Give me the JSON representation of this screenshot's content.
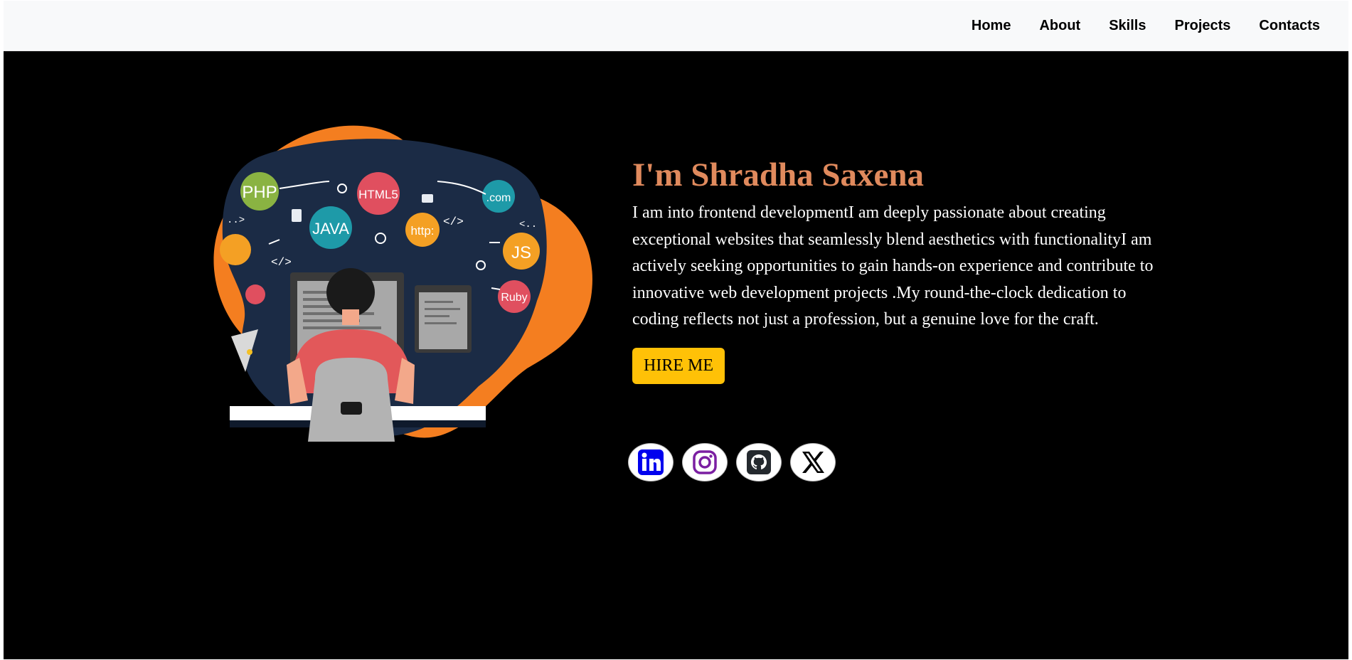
{
  "nav": {
    "items": [
      {
        "label": "Home"
      },
      {
        "label": "About"
      },
      {
        "label": "Skills"
      },
      {
        "label": "Projects"
      },
      {
        "label": "Contacts"
      }
    ]
  },
  "hero": {
    "title": "I'm Shradha Saxena",
    "description": "I am into frontend developmentI am deeply passionate about creating exceptional websites that seamlessly blend aesthetics with functionalityI am actively seeking opportunities to gain hands-on experience and contribute to innovative web development projects .My round-the-clock dedication to coding reflects not just a profession, but a genuine love for the craft.",
    "hire_label": "HIRE ME",
    "illustration_badges": [
      "PHP",
      "HTML5",
      "JAVA",
      "http:",
      ".com",
      "JS",
      "Ruby"
    ]
  },
  "socials": [
    {
      "icon": "linkedin-icon",
      "color": "#0a66c2"
    },
    {
      "icon": "instagram-icon",
      "color": "#7b1fa2"
    },
    {
      "icon": "github-icon",
      "color": "#24292e"
    },
    {
      "icon": "x-icon",
      "color": "#000000"
    }
  ],
  "colors": {
    "accent": "#e08a5d",
    "button": "#ffc107",
    "background": "#000000",
    "navbar": "#f8f9fa"
  }
}
